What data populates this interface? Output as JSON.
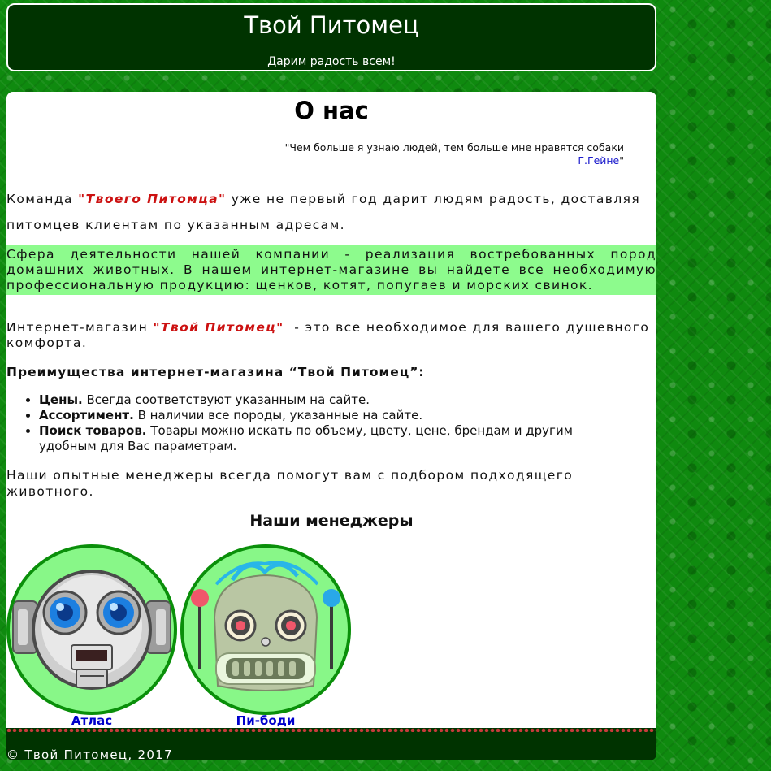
{
  "header": {
    "title": "Твой Питомец",
    "slogan": "Дарим радость всем!"
  },
  "about": {
    "title": "О нас",
    "quote_text": "\"Чем больше я узнаю людей, тем больше мне нравятся собаки",
    "quote_author": "Г.Гейне",
    "quote_close": "\"",
    "p1_before": "Команда ",
    "p1_accent": "\"Твоего Питомца\"",
    "p1_after": " уже не первый год дарит людям радость, доставляя питомцев клиентам по указанным адресам.",
    "p2": "Сфера деятельности нашей компании - реализация востребованных пород домашних животных. В нашем интернет-магазине вы найдете все необходимую профессиональную продукцию: щенков, котят, попугаев и морских свинок.",
    "p3_before": "Интернет-магазин ",
    "p3_accent": "\"Твой Питомец\"",
    "p3_after": "  - это все необходимое для вашего душевного комфорта.",
    "advantages_title": "Преимущества интернет-магазина “Твой Питомец”:",
    "advantages": [
      {
        "bold": "Цены.",
        "text": " Всегда соответствуют указанным на сайте."
      },
      {
        "bold": "Ассортимент.",
        "text": " В наличии все породы, указанные на сайте."
      },
      {
        "bold": "Поиск товаров.",
        "text": " Товары можно искать по объему, цвету, цене, брендам и другим удобным для Вас параметрам."
      }
    ],
    "p4": "Наши опытные менеджеры всегда помогут вам с подбором подходящего животного."
  },
  "managers": {
    "title": "Наши менеджеры",
    "items": [
      {
        "name": "Атлас",
        "icon": "robot-atlas-icon"
      },
      {
        "name": "Пи-боди",
        "icon": "robot-peabody-icon"
      }
    ]
  },
  "footer": {
    "text": "© Твой Питомец, 2017"
  },
  "colors": {
    "background": "#0f8a0f",
    "header": "#003300",
    "highlight": "#8dfb8d",
    "accent": "#cc1111",
    "link": "#0000cc"
  }
}
